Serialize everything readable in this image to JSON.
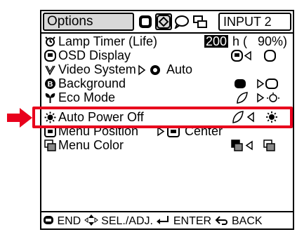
{
  "menu": {
    "title": "Options",
    "input_label": "INPUT  2",
    "tabs": [
      {
        "icon": "picture-tab-icon"
      },
      {
        "icon": "options-tab-icon"
      },
      {
        "icon": "speech-bubble-tab-icon"
      },
      {
        "icon": "network-tab-icon"
      }
    ]
  },
  "rows": {
    "lamp_timer": {
      "label": "Lamp Timer  (Life)",
      "value": "200",
      "unit": "h (",
      "percent": "90%)"
    },
    "osd_display": {
      "label": "OSD Display"
    },
    "video_system": {
      "label": "Video System",
      "value": "Auto"
    },
    "background": {
      "label": "Background"
    },
    "eco_mode": {
      "label": "Eco Mode"
    },
    "auto_power_off": {
      "label": "Auto Power Off"
    },
    "menu_position": {
      "label": "Menu Position",
      "value": "Center"
    },
    "menu_color": {
      "label": "Menu Color"
    }
  },
  "footer": {
    "end": "END",
    "sel": "SEL./ADJ.",
    "enter": "ENTER",
    "back": "BACK"
  },
  "colors": {
    "highlight": "#e8001c",
    "tab_active": "#d8d8d8"
  }
}
